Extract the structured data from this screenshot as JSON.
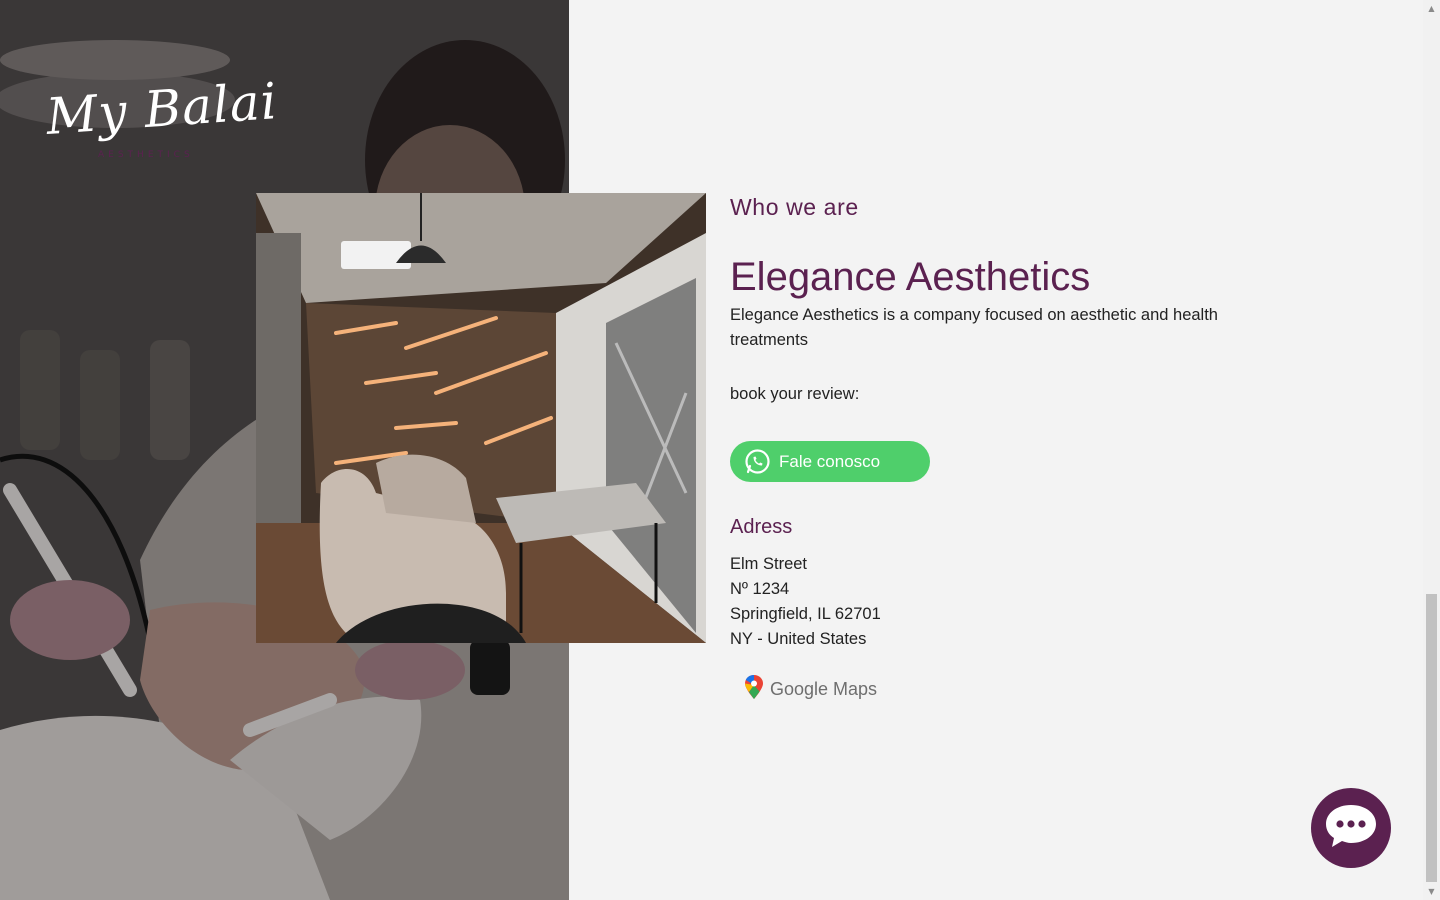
{
  "brand": {
    "logo": "My Balai",
    "logo_sub": "AESTHETICS"
  },
  "about": {
    "eyebrow": "Who we are",
    "title": "Elegance Aesthetics",
    "description": "Elegance Aesthetics is a company focused on aesthetic and health treatments",
    "book_label": "book your review:",
    "whatsapp_button": "Fale conosco"
  },
  "address": {
    "heading": "Adress",
    "lines": [
      "Elm Street",
      "Nº 1234",
      "Springfield, IL 62701",
      "NY - United States"
    ]
  },
  "maps_link": "Google Maps",
  "icons": {
    "whatsapp": "whatsapp-icon",
    "maps": "map-pin-icon",
    "chat": "chat-bubble-icon"
  },
  "colors": {
    "brand_purple": "#5b2150",
    "whatsapp_green": "#4fcf6b",
    "background": "#f3f3f3"
  }
}
